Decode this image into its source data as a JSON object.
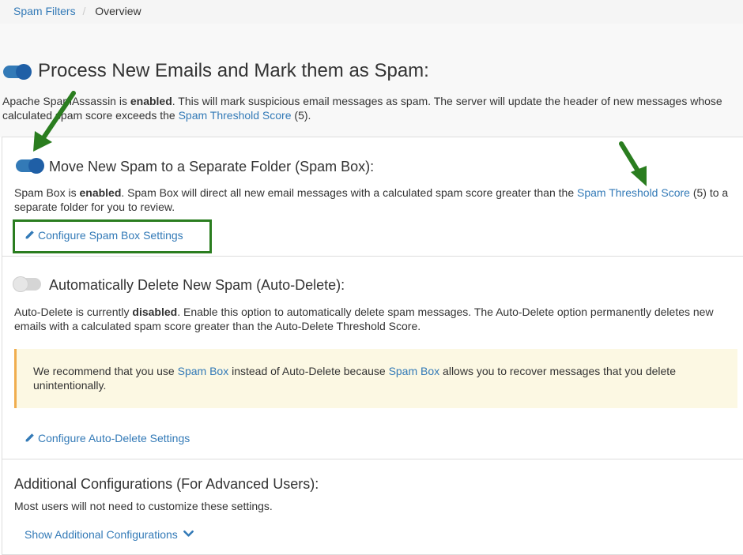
{
  "breadcrumb": {
    "parent": "Spam Filters",
    "separator": "/",
    "current": "Overview"
  },
  "main": {
    "title": "Process New Emails and Mark them as Spam:",
    "desc_before": "Apache SpamAssassin is ",
    "desc_bold": "enabled",
    "desc_after": ". This will mark suspicious email messages as spam. The server will update the header of new messages whose calculated spam score exceeds the ",
    "desc_link": "Spam Threshold Score",
    "desc_end": " (5)."
  },
  "spambox": {
    "title": "Move New Spam to a Separate Folder (Spam Box):",
    "desc_before": "Spam Box is ",
    "desc_bold": "enabled",
    "desc_mid": ". Spam Box will direct all new email messages with a calculated spam score greater than the ",
    "desc_link": "Spam Threshold Score",
    "desc_end": " (5) to a separate folder for you to review.",
    "configure_label": "Configure Spam Box Settings"
  },
  "autodelete": {
    "title": "Automatically Delete New Spam (Auto-Delete):",
    "desc_before": "Auto-Delete is currently ",
    "desc_bold": "disabled",
    "desc_after": ". Enable this option to automatically delete spam messages. The Auto-Delete option permanently deletes new emails with a calculated spam score greater than the Auto-Delete Threshold Score.",
    "warning_before": "We recommend that you use ",
    "warning_link1": "Spam Box",
    "warning_mid": " instead of Auto-Delete because ",
    "warning_link2": "Spam Box",
    "warning_end": " allows you to recover messages that you delete unintentionally.",
    "configure_label": "Configure Auto-Delete Settings"
  },
  "additional": {
    "title": "Additional Configurations (For Advanced Users):",
    "desc": "Most users will not need to customize these settings.",
    "show_label": "Show Additional Configurations"
  },
  "toggles": {
    "process_new_emails": true,
    "spam_box": true,
    "auto_delete": false
  },
  "icons": {
    "edit": "pencil-icon",
    "expand": "chevron-down-icon",
    "annotation": "green-arrow-icon"
  },
  "colors": {
    "link": "#337ab7",
    "toggle_on": "#337ab7",
    "warning_bg": "#fcf8e3",
    "warning_border": "#f0ad4e",
    "annotation_green": "#2a7d1f"
  }
}
